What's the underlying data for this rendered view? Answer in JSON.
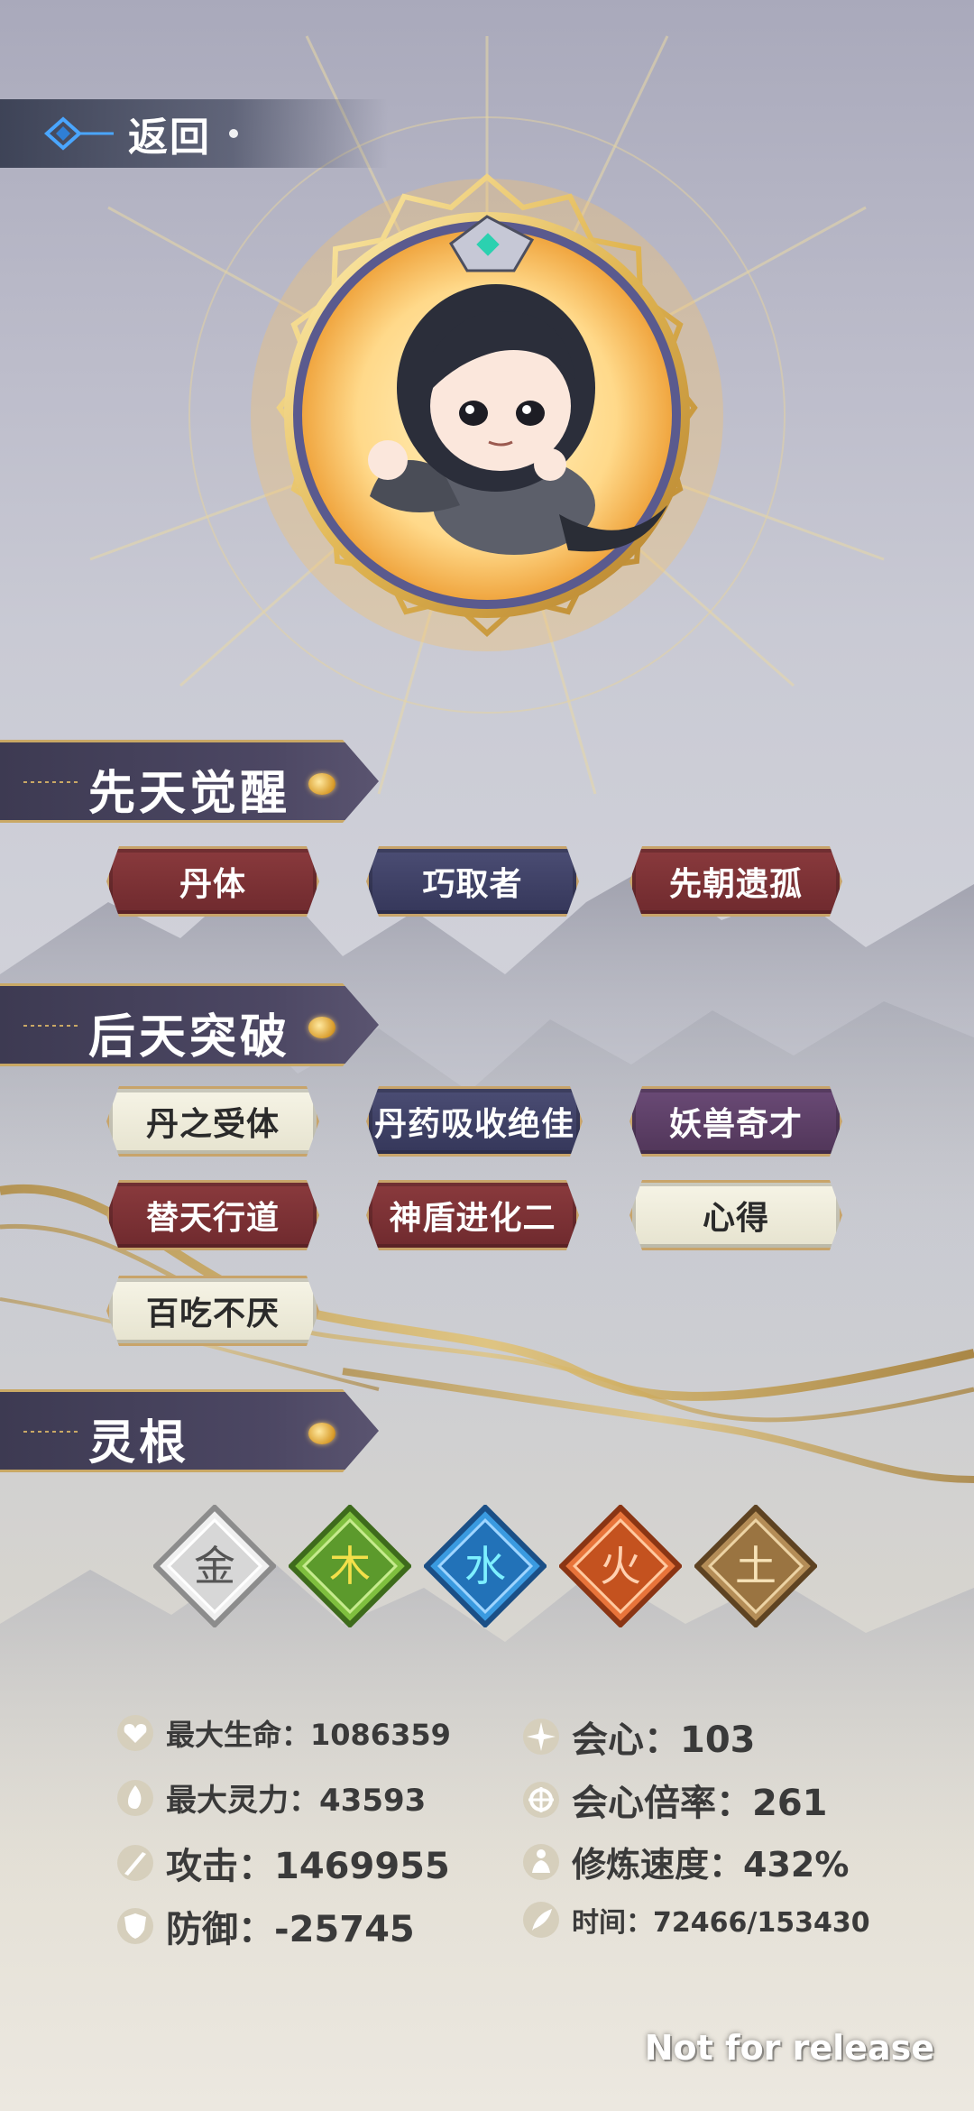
{
  "header": {
    "back_label": "返回"
  },
  "innate": {
    "title": "先天觉醒",
    "tags": [
      {
        "label": "丹体",
        "style": "red"
      },
      {
        "label": "巧取者",
        "style": "navy"
      },
      {
        "label": "先朝遗孤",
        "style": "red"
      }
    ]
  },
  "acquired": {
    "title": "后天突破",
    "tags": [
      {
        "label": "丹之受体",
        "style": "cream"
      },
      {
        "label": "丹药吸收绝佳",
        "style": "navy"
      },
      {
        "label": "妖兽奇才",
        "style": "purple"
      },
      {
        "label": "替天行道",
        "style": "red"
      },
      {
        "label": "神盾进化二",
        "style": "red"
      },
      {
        "label": "心得",
        "style": "cream"
      },
      {
        "label": "百吃不厌",
        "style": "cream"
      }
    ]
  },
  "spirit_root": {
    "title": "灵根",
    "elements": [
      {
        "char": "金",
        "color": "#c9c9c9",
        "icon": "metal-element-icon"
      },
      {
        "char": "木",
        "color": "#6ea93a",
        "icon": "wood-element-icon"
      },
      {
        "char": "水",
        "color": "#2f86c6",
        "icon": "water-element-icon"
      },
      {
        "char": "火",
        "color": "#d8662c",
        "icon": "fire-element-icon"
      },
      {
        "char": "土",
        "color": "#a57d4a",
        "icon": "earth-element-icon"
      }
    ]
  },
  "stats": {
    "max_hp": "最大生命：1086359",
    "max_spirit": "最大灵力：43593",
    "attack": "攻击：1469955",
    "defense": "防御：-25745",
    "crit": "会心：103",
    "crit_rate": "会心倍率：261",
    "cultivation_speed": "修炼速度：432%",
    "time": "时间：72466/153430"
  },
  "watermark": "Not for release"
}
